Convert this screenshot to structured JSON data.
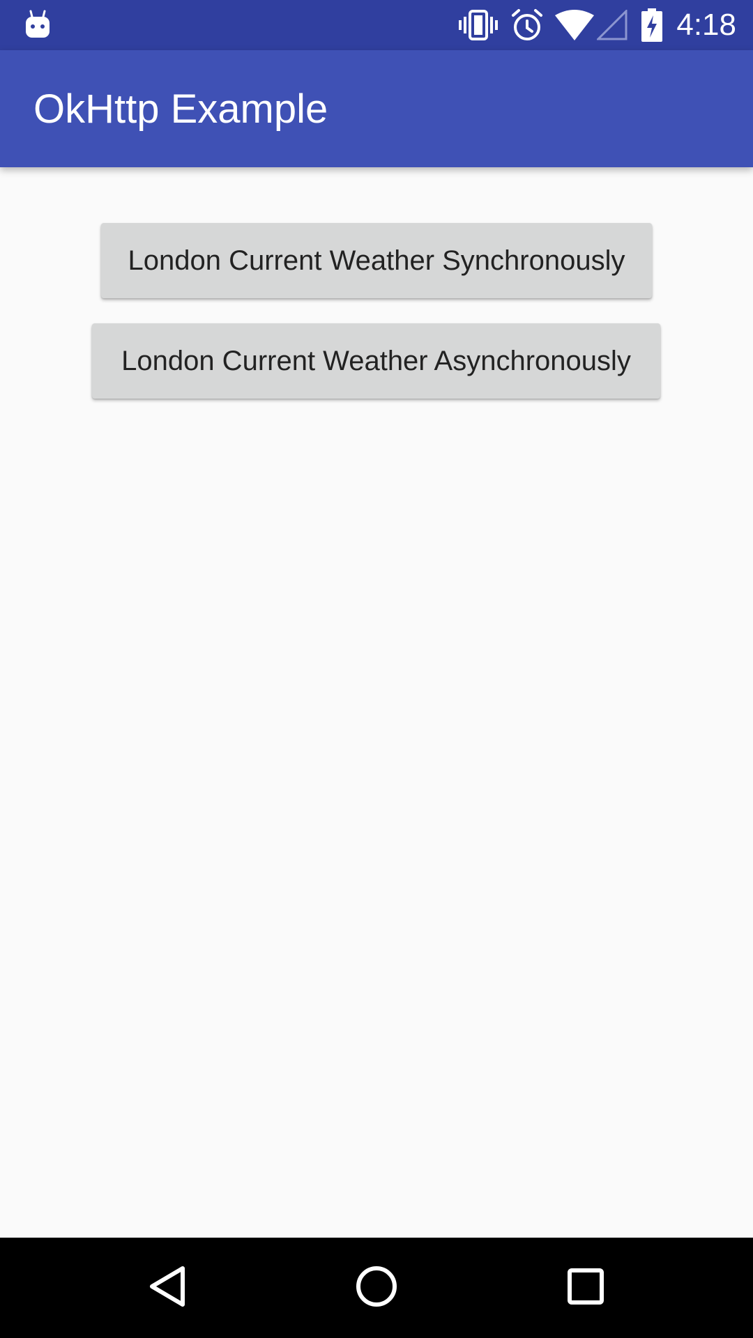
{
  "status_bar": {
    "time": "4:18",
    "icons": [
      "android-notification-icon",
      "vibrate-icon",
      "alarm-icon",
      "wifi-icon",
      "signal-icon",
      "battery-charging-icon"
    ]
  },
  "app_bar": {
    "title": "OkHttp Example"
  },
  "main": {
    "buttons": [
      {
        "label": "London Current Weather Synchronously"
      },
      {
        "label": "London Current Weather Asynchronously"
      }
    ]
  },
  "nav_bar": {
    "icons": [
      "back-icon",
      "home-icon",
      "recents-icon"
    ]
  },
  "colors": {
    "status_bar": "#303f9f",
    "app_bar": "#3f51b5",
    "background": "#fafafa",
    "button": "#d6d7d7",
    "nav_bar": "#000000"
  }
}
